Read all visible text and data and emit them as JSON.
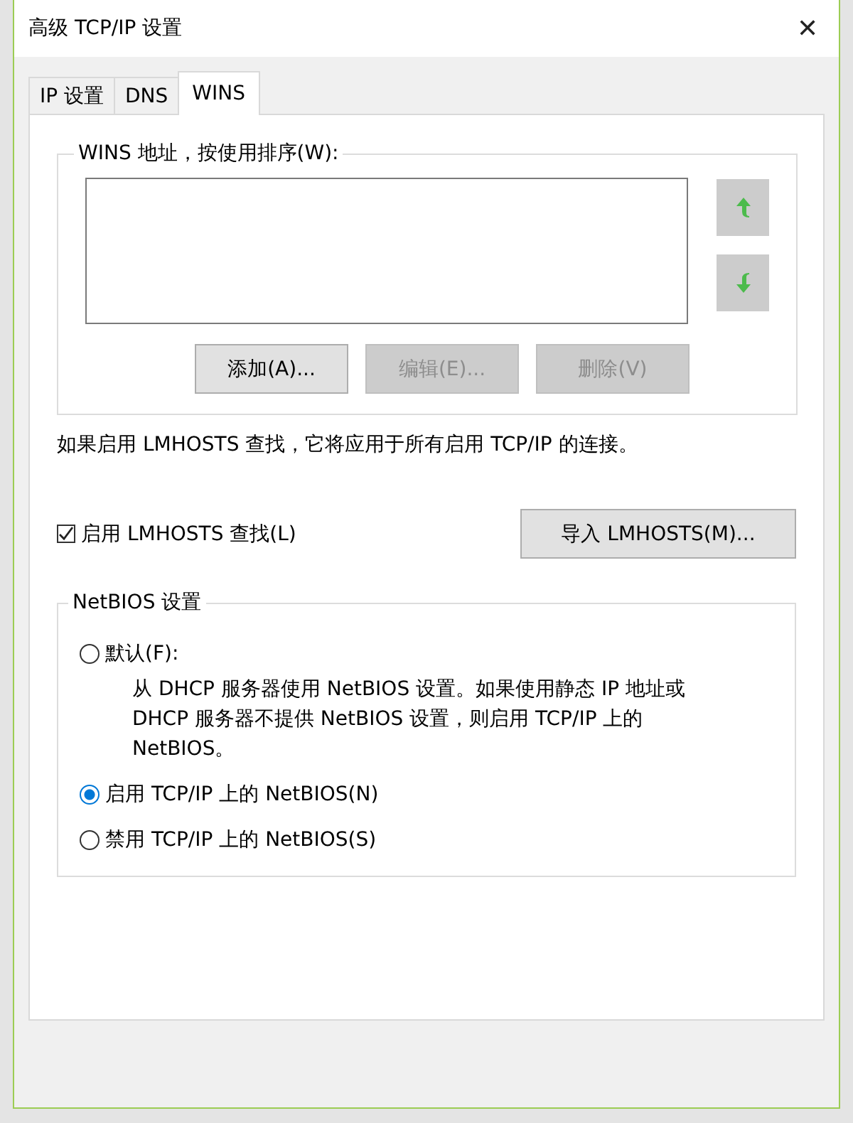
{
  "window": {
    "title": "高级 TCP/IP 设置",
    "close": "✕"
  },
  "tabs": [
    {
      "label": "IP 设置",
      "selected": false
    },
    {
      "label": "DNS",
      "selected": false
    },
    {
      "label": "WINS",
      "selected": true
    }
  ],
  "wins": {
    "group_title": "WINS 地址，按使用排序(W):",
    "buttons": [
      {
        "label": "添加(A)...",
        "disabled": false
      },
      {
        "label": "编辑(E)...",
        "disabled": true
      },
      {
        "label": "删除(V)",
        "disabled": true
      }
    ]
  },
  "lmhosts": {
    "note": "如果启用 LMHOSTS 查找，它将应用于所有启用 TCP/IP 的连接。",
    "checkbox": {
      "label": "启用 LMHOSTS 查找(L)",
      "checked": true
    },
    "import_button": "导入 LMHOSTS(M)..."
  },
  "netbios": {
    "group_title": "NetBIOS 设置",
    "options": [
      {
        "label": "默认(F):",
        "selected": false,
        "description": "从 DHCP 服务器使用 NetBIOS 设置。如果使用静态 IP 地址或 DHCP 服务器不提供 NetBIOS 设置，则启用 TCP/IP 上的 NetBIOS。"
      },
      {
        "label": "启用 TCP/IP 上的 NetBIOS(N)",
        "selected": true
      },
      {
        "label": "禁用 TCP/IP 上的 NetBIOS(S)",
        "selected": false
      }
    ]
  }
}
